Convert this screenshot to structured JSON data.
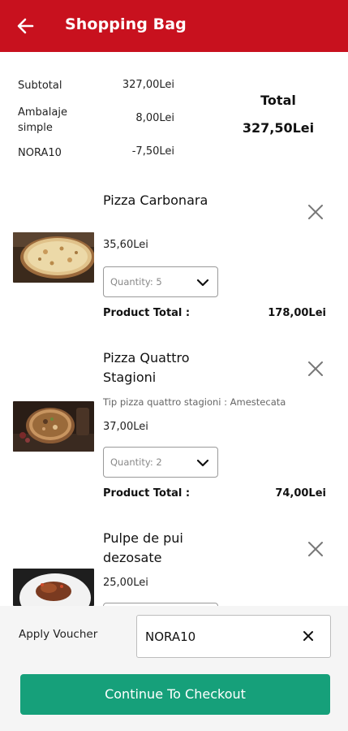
{
  "header": {
    "title": "Shopping Bag",
    "back_icon": "arrow-left-icon",
    "bg_color": "#c8111e"
  },
  "summary": {
    "rows": [
      {
        "label": "Subtotal",
        "value": "327,00Lei"
      },
      {
        "label": "Ambalaje simple",
        "value": "8,00Lei"
      },
      {
        "label": "NORA10",
        "value": "-7,50Lei"
      }
    ],
    "total_label": "Total",
    "total_value": "327,50Lei"
  },
  "cart": {
    "items": [
      {
        "name": "Pizza Carbonara",
        "variant": "",
        "price": "35,60Lei",
        "quantity_text": "Quantity: 5",
        "product_total_label": "Product Total :",
        "product_total": "178,00Lei"
      },
      {
        "name": "Pizza Quattro Stagioni",
        "variant": "Tip pizza quattro stagioni : Amestecata",
        "price": "37,00Lei",
        "quantity_text": "Quantity: 2",
        "product_total_label": "Product Total :",
        "product_total": "74,00Lei"
      },
      {
        "name": "Pulpe de pui dezosate",
        "variant": "",
        "price": "25,00Lei",
        "quantity_text": "",
        "product_total_label": "",
        "product_total": ""
      }
    ]
  },
  "voucher": {
    "label": "Apply Voucher",
    "value": "NORA10",
    "clear_icon": "close-icon"
  },
  "checkout": {
    "label": "Continue To Checkout",
    "color": "#16a07a"
  }
}
